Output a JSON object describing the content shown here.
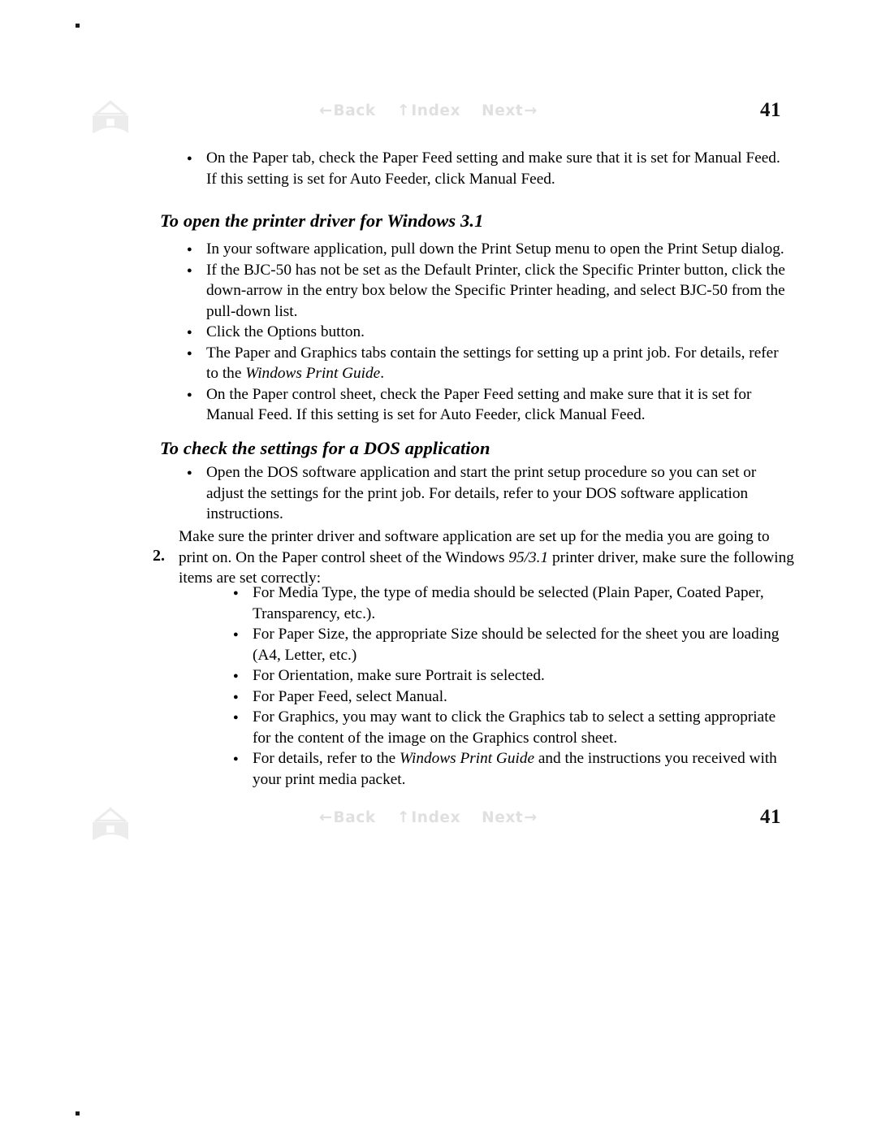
{
  "page": {
    "page_number": "41",
    "corner_marks": [
      ".",
      "."
    ]
  },
  "nav": {
    "home_icon": "home-icon",
    "links": [
      {
        "id": "back",
        "label": "Back",
        "arrow": "←",
        "arrow_side": "before"
      },
      {
        "id": "index",
        "label": "Index",
        "arrow": "↑",
        "arrow_side": "before"
      },
      {
        "id": "next",
        "label": "Next",
        "arrow": "→",
        "arrow_side": "after"
      }
    ],
    "color": "#e0e0e0"
  },
  "content": {
    "top_bullets": [
      "On the Paper tab, check the Paper Feed setting and make sure that it is set for Manual Feed. If this setting is set for Auto Feeder, click Manual Feed."
    ],
    "heading_1": "To open the printer driver for Windows 3.1",
    "section_1_bullets": [
      "In your software application, pull down the Print Setup menu to open the Print Setup dialog.",
      "If the BJC-50 has not be set as the Default Printer, click the Specific Printer button, click the down-arrow in the entry box below the Specific Printer heading, and select BJC-50 from the pull-down list.",
      "Click the Options button."
    ],
    "section_1_bullet_4_pre": "The Paper and Graphics tabs contain the settings for setting up a print job. For details, refer to the ",
    "section_1_bullet_4_italic": "Windows Print Guide",
    "section_1_bullet_4_post": ".",
    "section_1_bullet_5": "On the Paper control sheet, check the Paper Feed setting and make sure that it is set for Manual Feed. If this setting is set for Auto Feeder, click Manual Feed.",
    "heading_2": "To check the settings for a DOS application",
    "section_2_bullets": [
      "Open the DOS software application and start the print setup procedure so you can set or adjust the settings for the print job. For details, refer to your DOS software application instructions."
    ],
    "step_2": {
      "marker": "2.",
      "text_pre": "Make sure the printer driver and software application are set up for the media you are going to print on. On the Paper control sheet of the Windows ",
      "text_italic": "95/3.1",
      "text_post": " printer driver, make sure the following items are set correctly:"
    },
    "step_2_bullets": [
      "For Media Type, the type of media should be selected (Plain Paper, Coated Paper, Transparency, etc.).",
      "For Paper Size, the appropriate Size should be selected for the sheet you are loading (A4, Letter, etc.)",
      "For Orientation, make sure Portrait is selected.",
      "For Paper Feed, select Manual.",
      "For Graphics, you may want to click the Graphics tab to select a setting appropriate for the content of the image on the Graphics control sheet."
    ],
    "step_2_last_bullet_pre": "For details, refer to the ",
    "step_2_last_bullet_italic": "Windows Print Guide",
    "step_2_last_bullet_post": " and the instructions you received with your print media packet."
  }
}
